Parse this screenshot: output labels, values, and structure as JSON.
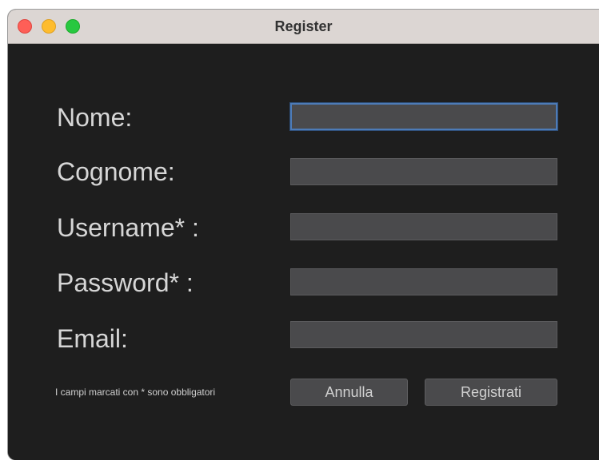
{
  "window": {
    "title": "Register"
  },
  "form": {
    "fields": [
      {
        "label": "Nome:",
        "value": "",
        "placeholder": ""
      },
      {
        "label": "Cognome:",
        "value": "",
        "placeholder": ""
      },
      {
        "label": "Username* :",
        "value": "",
        "placeholder": ""
      },
      {
        "label": "Password* :",
        "value": "",
        "placeholder": ""
      },
      {
        "label": "Email:",
        "value": "",
        "placeholder": ""
      }
    ],
    "hint": "I campi marcati con * sono obbligatori",
    "cancel_label": "Annulla",
    "submit_label": "Registrati"
  },
  "colors": {
    "background": "#1e1e1e",
    "field": "#4a4a4c",
    "focus_ring": "#4d7bb7",
    "close": "#fe5f57",
    "minimize": "#febc2e",
    "maximize": "#28c840"
  }
}
